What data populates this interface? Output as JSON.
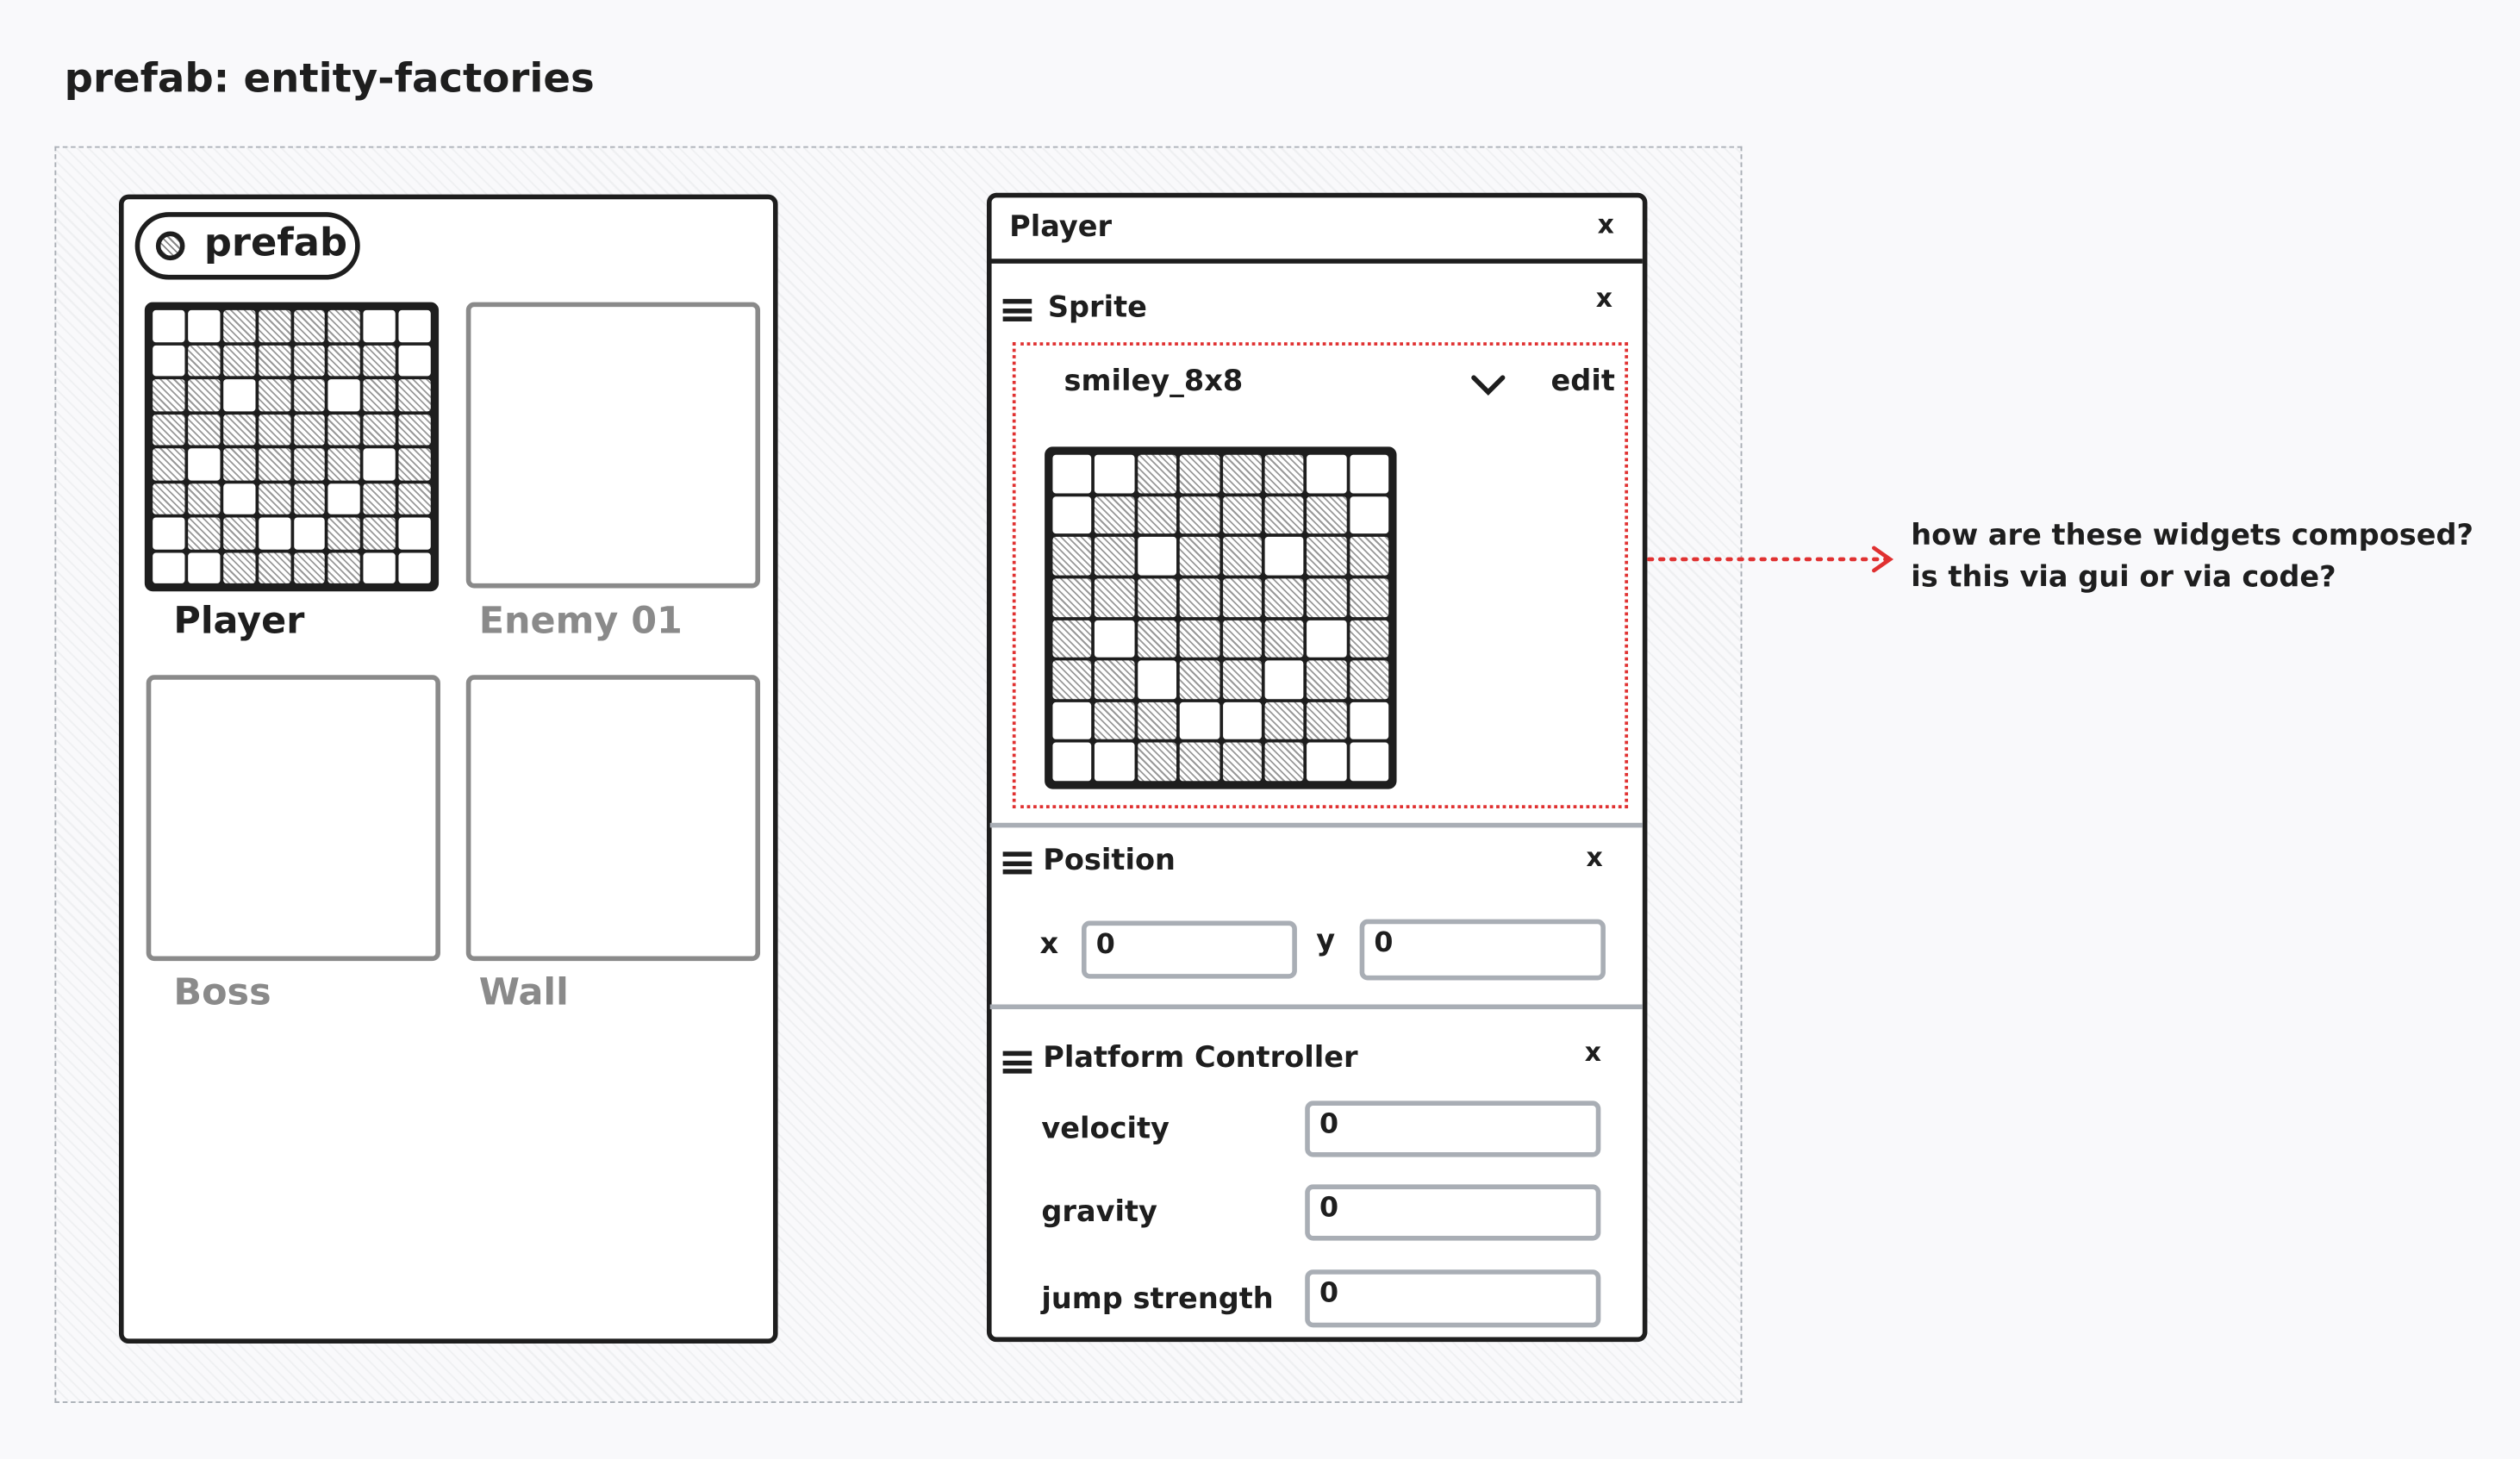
{
  "title": "prefab: entity-factories",
  "prefab_panel": {
    "badge_label": "prefab",
    "items": [
      {
        "label": "Player",
        "has_sprite": true,
        "active": true
      },
      {
        "label": "Enemy 01",
        "has_sprite": false,
        "active": false
      },
      {
        "label": "Boss",
        "has_sprite": false,
        "active": false
      },
      {
        "label": "Wall",
        "has_sprite": false,
        "active": false
      }
    ]
  },
  "sprite_pattern": [
    "00111100",
    "01111110",
    "11011011",
    "11111111",
    "10111101",
    "11011011",
    "01100110",
    "00111100"
  ],
  "inspector": {
    "title": "Player",
    "close_icon": "x",
    "sprite": {
      "title": "Sprite",
      "close_icon": "x",
      "selected_sprite": "smiley_8x8",
      "edit_label": "edit"
    },
    "position": {
      "title": "Position",
      "close_icon": "x",
      "x_label": "x",
      "x_value": "0",
      "y_label": "y",
      "y_value": "0"
    },
    "platform_controller": {
      "title": "Platform Controller",
      "close_icon": "x",
      "fields": [
        {
          "label": "velocity",
          "value": "0"
        },
        {
          "label": "gravity",
          "value": "0"
        },
        {
          "label": "jump strength",
          "value": "0"
        }
      ]
    }
  },
  "annotation": {
    "line1": "how are these widgets composed?",
    "line2": "is this via gui or via code?"
  },
  "colors": {
    "highlight": "#e03131",
    "stroke": "#1e1e1e",
    "muted": "#8a8a8a",
    "input_border": "#a9aeb5"
  }
}
